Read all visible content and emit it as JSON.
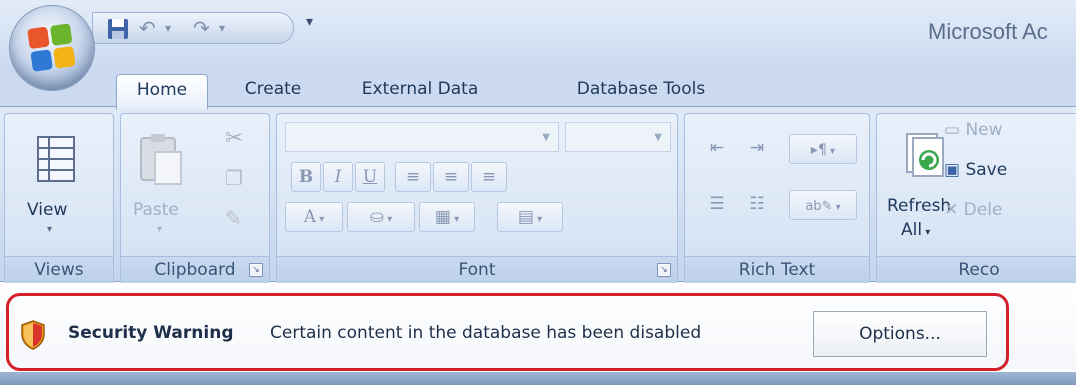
{
  "title_bar": {
    "app_title": "Microsoft Ac",
    "office_button_icon": "office-logo-icon",
    "quick_access": [
      "save-icon",
      "undo-icon",
      "redo-icon",
      "customize-dropdown-icon"
    ]
  },
  "tabs": [
    {
      "label": "Home",
      "active": true
    },
    {
      "label": "Create",
      "active": false
    },
    {
      "label": "External Data",
      "active": false
    },
    {
      "label": "Database Tools",
      "active": false
    }
  ],
  "ribbon": {
    "views": {
      "button_label": "View",
      "group_label": "Views"
    },
    "clipboard": {
      "paste_label": "Paste",
      "group_label": "Clipboard"
    },
    "font": {
      "bold": "B",
      "italic": "I",
      "underline": "U",
      "font_color": "A",
      "group_label": "Font"
    },
    "rich_text": {
      "group_label": "Rich Text"
    },
    "records": {
      "refresh_label": "Refresh",
      "refresh_all_label": "All",
      "new_label": "New",
      "save_label": "Save",
      "delete_label": "Dele",
      "group_label": "Reco"
    }
  },
  "message_bar": {
    "title": "Security Warning",
    "text": "Certain content in the database has been disabled",
    "options_button": "Options..."
  },
  "colors": {
    "ribbon_blue": "#d3e1f3",
    "tab_text": "#1e395b",
    "highlight_red": "#d4202a"
  }
}
